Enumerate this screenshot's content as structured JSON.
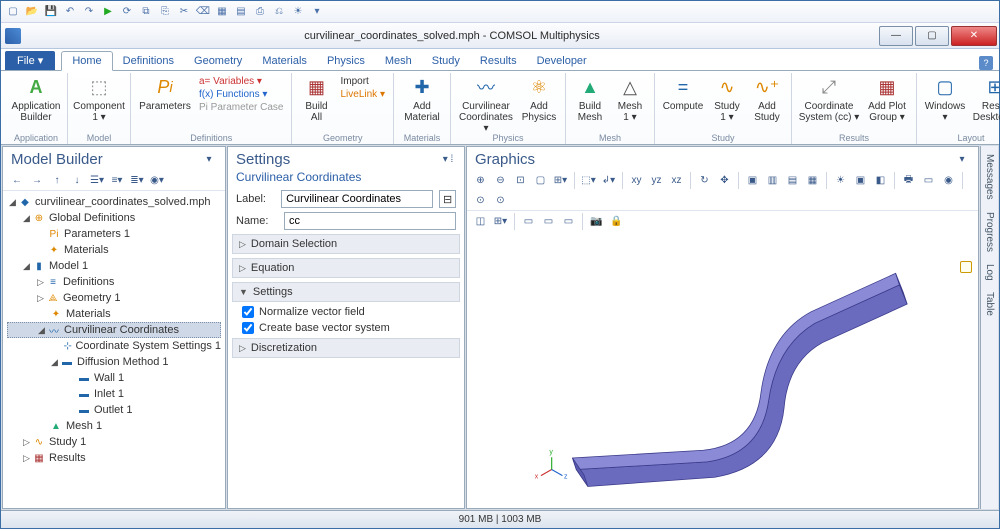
{
  "window": {
    "title": "curvilinear_coordinates_solved.mph - COMSOL Multiphysics"
  },
  "tabs": {
    "file": "File ▾",
    "items": [
      "Home",
      "Definitions",
      "Geometry",
      "Materials",
      "Physics",
      "Mesh",
      "Study",
      "Results",
      "Developer"
    ],
    "active": 0
  },
  "ribbon": {
    "groups": {
      "application": {
        "label": "Application",
        "builder": "Application\nBuilder"
      },
      "model": {
        "label": "Model",
        "component": "Component\n1 ▾"
      },
      "definitions": {
        "label": "Definitions",
        "parameters": "Parameters",
        "variables": "a= Variables ▾",
        "functions": "f(x) Functions ▾",
        "paramcase": "Pi  Parameter Case"
      },
      "geometry": {
        "label": "Geometry",
        "buildall": "Build\nAll",
        "import": "Import",
        "livelink": "LiveLink ▾"
      },
      "materials": {
        "label": "Materials",
        "add": "Add\nMaterial"
      },
      "physics": {
        "label": "Physics",
        "curv": "Curvilinear\nCoordinates ▾",
        "add": "Add\nPhysics"
      },
      "mesh": {
        "label": "Mesh",
        "build": "Build\nMesh",
        "mesh1": "Mesh\n1 ▾"
      },
      "study": {
        "label": "Study",
        "compute": "Compute",
        "study1": "Study\n1 ▾",
        "add": "Add\nStudy"
      },
      "results": {
        "label": "Results",
        "coord": "Coordinate\nSystem (cc) ▾",
        "plot": "Add Plot\nGroup ▾"
      },
      "layout": {
        "label": "Layout",
        "windows": "Windows\n▾",
        "reset": "Reset\nDesktop ▾"
      }
    }
  },
  "modelbuilder": {
    "title": "Model Builder",
    "root": "curvilinear_coordinates_solved.mph",
    "tree": {
      "globaldef": "Global Definitions",
      "params1": "Parameters 1",
      "materials": "Materials",
      "model1": "Model 1",
      "definitions": "Definitions",
      "geometry1": "Geometry 1",
      "materials2": "Materials",
      "curvcoord": "Curvilinear Coordinates",
      "css1": "Coordinate System Settings 1",
      "diff1": "Diffusion Method 1",
      "wall1": "Wall 1",
      "inlet1": "Inlet 1",
      "outlet1": "Outlet 1",
      "mesh1": "Mesh 1",
      "study1": "Study 1",
      "results": "Results"
    }
  },
  "settings": {
    "title": "Settings",
    "subtitle": "Curvilinear Coordinates",
    "label_lbl": "Label:",
    "label_val": "Curvilinear Coordinates",
    "name_lbl": "Name:",
    "name_val": "cc",
    "sec_domain": "Domain Selection",
    "sec_equation": "Equation",
    "sec_settings": "Settings",
    "chk_norm": "Normalize vector field",
    "chk_base": "Create base vector system",
    "sec_disc": "Discretization"
  },
  "graphics": {
    "title": "Graphics"
  },
  "sidetabs": [
    "Messages",
    "Progress",
    "Log",
    "Table"
  ],
  "status": "901 MB | 1003 MB"
}
